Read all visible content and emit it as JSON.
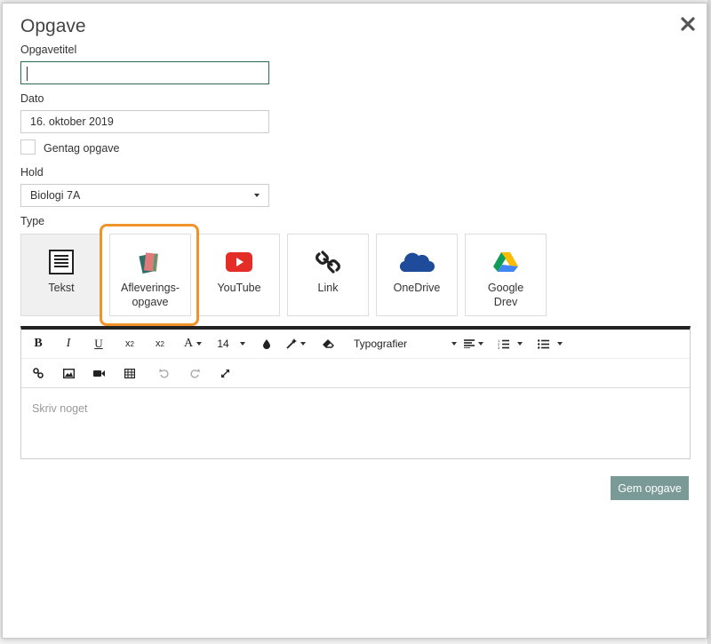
{
  "modal": {
    "title": "Opgave",
    "fields": {
      "title_label": "Opgavetitel",
      "title_value": "",
      "date_label": "Dato",
      "date_value": "16. oktober 2019",
      "repeat_label": "Gentag opgave",
      "repeat_checked": false,
      "class_label": "Hold",
      "class_value": "Biologi 7A",
      "type_label": "Type"
    },
    "types": [
      {
        "label_line1": "Tekst",
        "label_line2": "",
        "icon": "text-icon"
      },
      {
        "label_line1": "Afleverings-",
        "label_line2": "opgave",
        "icon": "assignment-icon",
        "selected": true
      },
      {
        "label_line1": "YouTube",
        "label_line2": "",
        "icon": "youtube-icon"
      },
      {
        "label_line1": "Link",
        "label_line2": "",
        "icon": "link-icon"
      },
      {
        "label_line1": "OneDrive",
        "label_line2": "",
        "icon": "onedrive-icon"
      },
      {
        "label_line1": "Google",
        "label_line2": "Drev",
        "icon": "google-drive-icon"
      }
    ],
    "editor": {
      "font_size": "14",
      "style_select": "Typografier",
      "placeholder": "Skriv noget"
    },
    "save_label": "Gem opgave",
    "colors": {
      "accent_highlight": "#f0932b",
      "save_button": "#7a9a97",
      "active_input_border": "#2d6b4f"
    }
  }
}
